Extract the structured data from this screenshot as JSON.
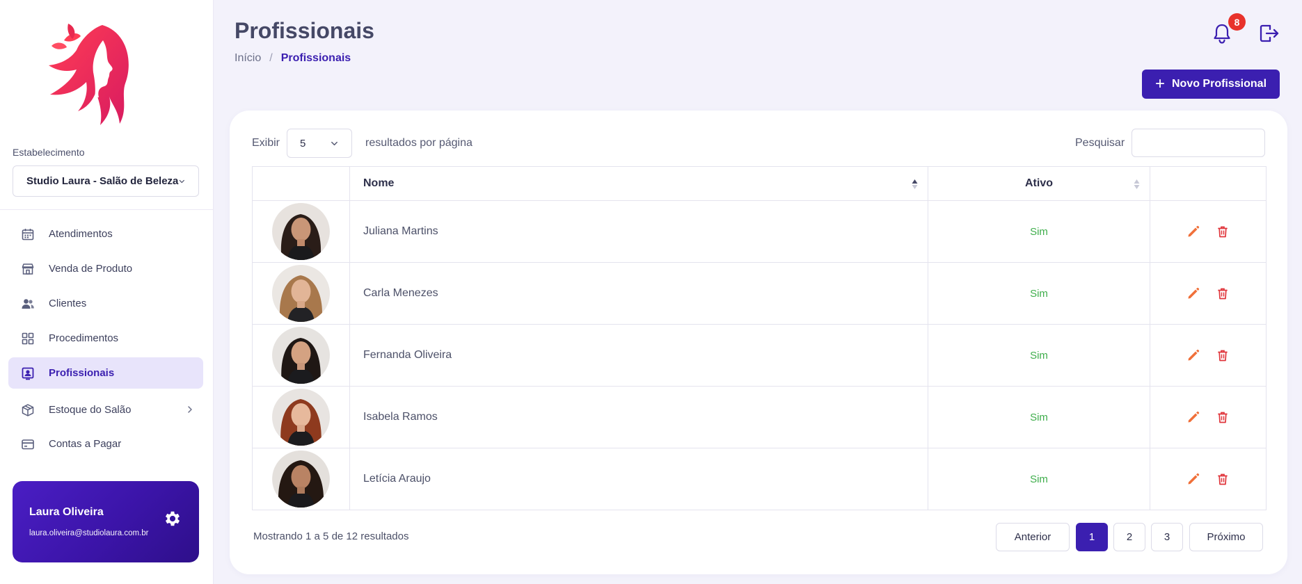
{
  "sidebar": {
    "establishment_label": "Estabelecimento",
    "establishment_value": "Studio Laura - Salão de Beleza",
    "nav": [
      {
        "label": "Atendimentos",
        "icon": "calendar-icon"
      },
      {
        "label": "Venda de Produto",
        "icon": "store-icon"
      },
      {
        "label": "Clientes",
        "icon": "users-icon"
      },
      {
        "label": "Procedimentos",
        "icon": "grid-icon"
      },
      {
        "label": "Profissionais",
        "icon": "id-badge-icon",
        "active": true
      },
      {
        "label": "Estoque do Salão",
        "icon": "box-icon",
        "has_submenu": true
      },
      {
        "label": "Contas a Pagar",
        "icon": "credit-card-icon"
      }
    ],
    "user": {
      "name": "Laura Oliveira",
      "email": "laura.oliveira@studiolaura.com.br"
    }
  },
  "header": {
    "title": "Profissionais",
    "breadcrumb": {
      "home": "Início",
      "separator": "/",
      "current": "Profissionais"
    },
    "notifications_count": "8",
    "new_button_label": "Novo Profissional"
  },
  "table_controls": {
    "show_label": "Exibir",
    "per_page_value": "5",
    "per_page_suffix": "resultados por página",
    "search_label": "Pesquisar",
    "search_value": ""
  },
  "table": {
    "columns": [
      "",
      "Nome",
      "Ativo",
      ""
    ],
    "rows": [
      {
        "name": "Juliana Martins",
        "active": "Sim"
      },
      {
        "name": "Carla Menezes",
        "active": "Sim"
      },
      {
        "name": "Fernanda Oliveira",
        "active": "Sim"
      },
      {
        "name": "Isabela Ramos",
        "active": "Sim"
      },
      {
        "name": "Letícia Araujo",
        "active": "Sim"
      }
    ]
  },
  "footer": {
    "showing": "Mostrando 1 a 5 de 12 resultados",
    "pagination": {
      "prev": "Anterior",
      "pages": [
        "1",
        "2",
        "3"
      ],
      "current": "1",
      "next": "Próximo"
    }
  },
  "colors": {
    "primary": "#3b1fb0",
    "active_bg": "#e8e4fb",
    "success_text": "#3fae4c",
    "edit_icon": "#f0703a",
    "delete_icon": "#e0353b",
    "badge": "#e8322b"
  }
}
